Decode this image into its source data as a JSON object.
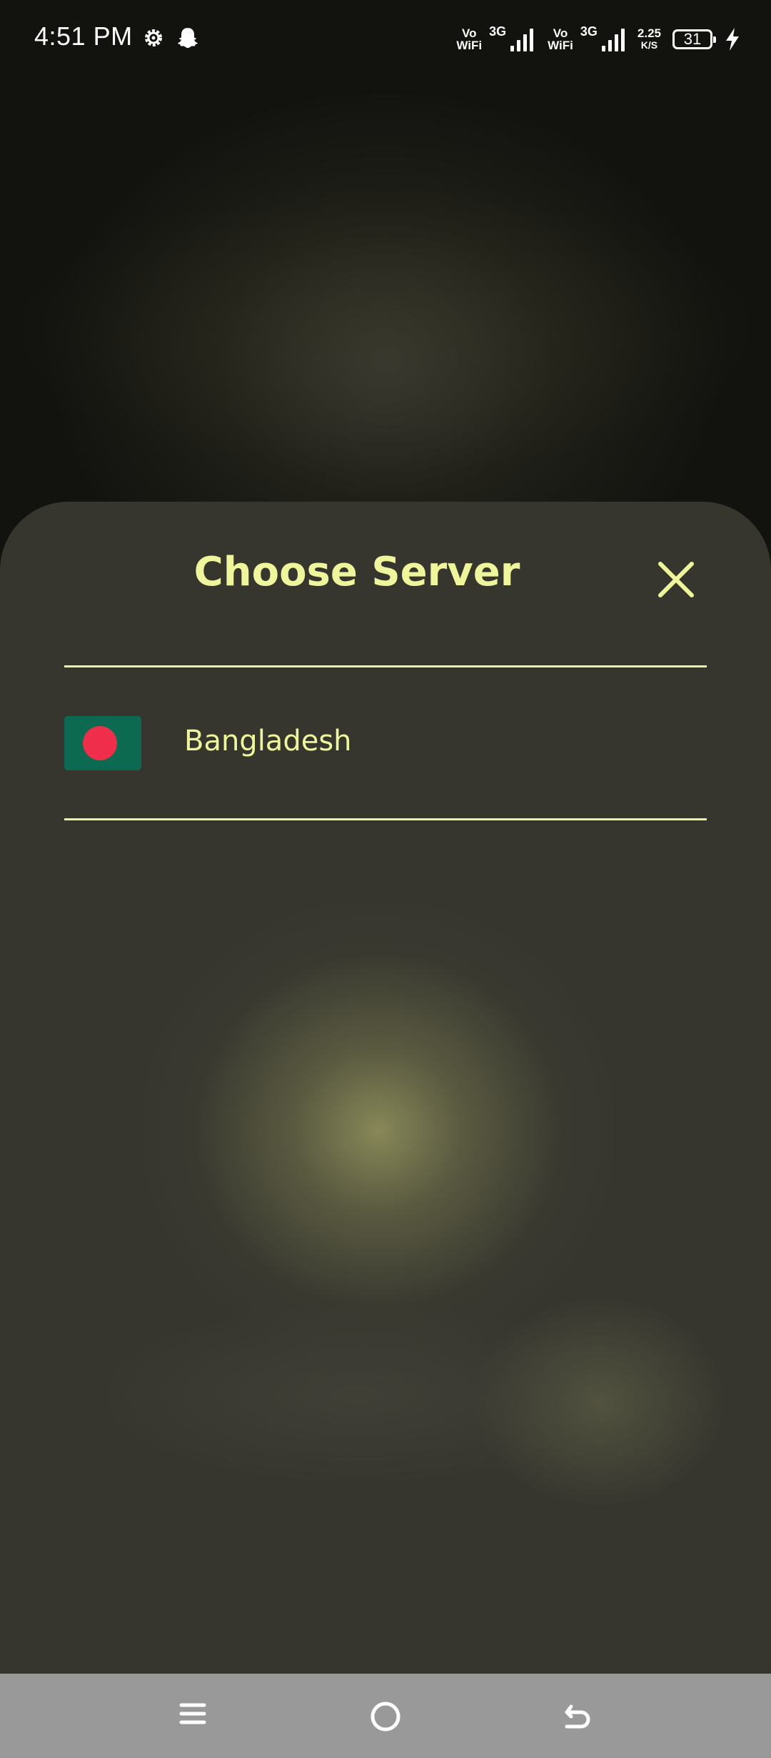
{
  "status_bar": {
    "time": "4:51 PM",
    "sim1": {
      "top": "Vo",
      "bottom": "WiFi",
      "network": "3G"
    },
    "sim2": {
      "top": "Vo",
      "bottom": "WiFi",
      "network": "3G"
    },
    "speed_value": "2.25",
    "speed_unit": "K/S",
    "battery": "31",
    "icons": [
      "settings-gear-icon",
      "snapchat-ghost-icon",
      "charging-bolt-icon"
    ]
  },
  "sheet": {
    "title": "Choose Server",
    "close_icon": "close-icon",
    "servers": [
      {
        "name": "Bangladesh",
        "flag": "bangladesh-flag-icon"
      }
    ]
  },
  "nav_bar": {
    "buttons": [
      "menu-icon",
      "home-icon",
      "back-icon"
    ]
  },
  "colors": {
    "accent": "#eef59a",
    "sheet_bg": "#36362f",
    "nav_bg": "#999999",
    "flag_green": "#0b6a50",
    "flag_red": "#ee2e4a"
  }
}
